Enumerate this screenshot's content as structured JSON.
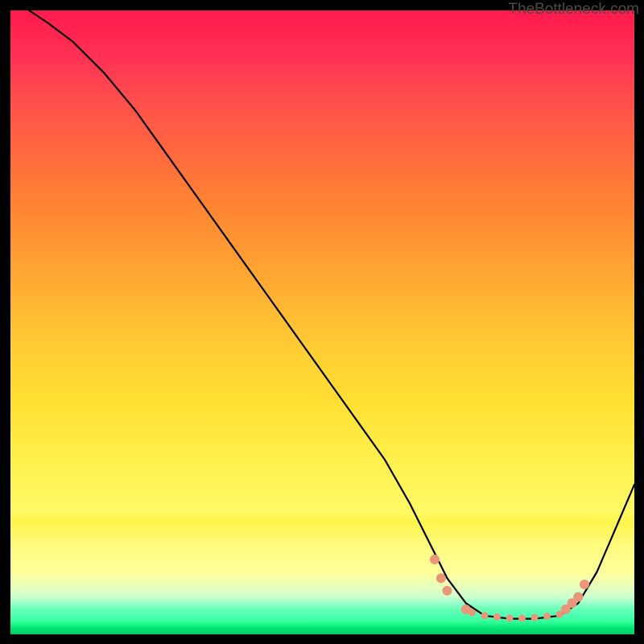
{
  "watermark": "TheBottleneck.com",
  "chart_data": {
    "type": "line",
    "title": "",
    "xlabel": "",
    "ylabel": "",
    "xlim": [
      0,
      100
    ],
    "ylim": [
      0,
      100
    ],
    "grid": false,
    "legend": false,
    "background": "rainbow-gradient-vertical",
    "series": [
      {
        "name": "bottleneck-curve",
        "color": "#000000",
        "x": [
          3,
          6,
          10,
          15,
          20,
          25,
          30,
          35,
          40,
          45,
          50,
          55,
          60,
          64,
          68,
          70,
          73,
          76,
          80,
          84,
          88,
          91,
          94,
          97,
          100
        ],
        "y": [
          100,
          98,
          95,
          90,
          84,
          77,
          70,
          63,
          56,
          49,
          42,
          35,
          28,
          21,
          13,
          9,
          5,
          3,
          2.5,
          2.5,
          3,
          5,
          10,
          17,
          24
        ]
      }
    ],
    "dotted_region": {
      "name": "highlight-dots",
      "color": "#e9967a",
      "points": [
        {
          "x": 68,
          "y": 12
        },
        {
          "x": 69,
          "y": 9
        },
        {
          "x": 70,
          "y": 7
        },
        {
          "x": 73,
          "y": 4
        },
        {
          "x": 74,
          "y": 3.5
        },
        {
          "x": 76,
          "y": 3
        },
        {
          "x": 78,
          "y": 2.8
        },
        {
          "x": 80,
          "y": 2.6
        },
        {
          "x": 82,
          "y": 2.6
        },
        {
          "x": 84,
          "y": 2.7
        },
        {
          "x": 86,
          "y": 2.9
        },
        {
          "x": 88,
          "y": 3.2
        },
        {
          "x": 89,
          "y": 4
        },
        {
          "x": 90,
          "y": 5
        },
        {
          "x": 91,
          "y": 6
        },
        {
          "x": 92,
          "y": 8
        }
      ]
    }
  }
}
